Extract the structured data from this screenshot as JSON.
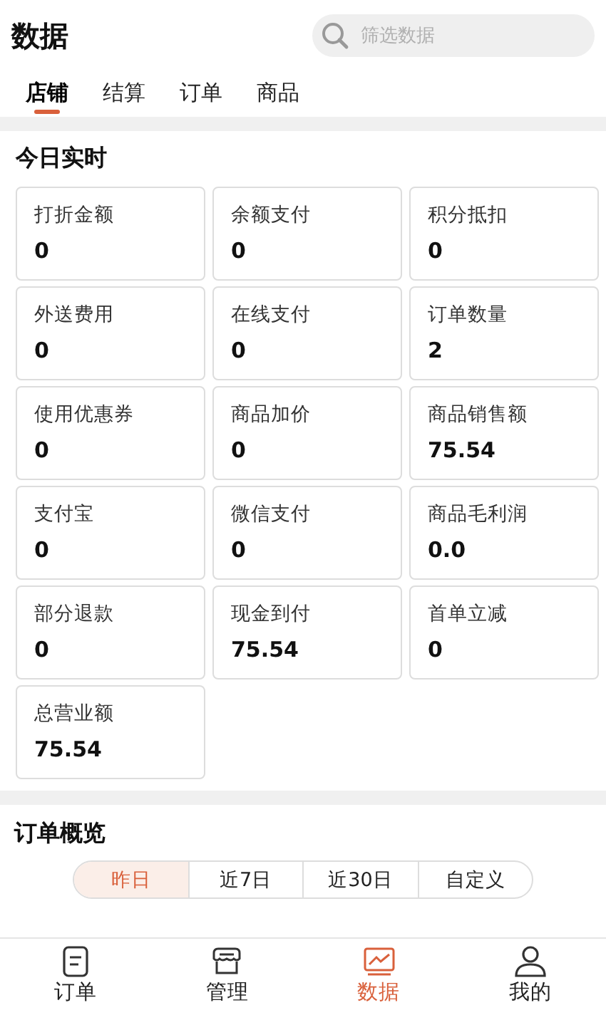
{
  "header": {
    "title": "数据",
    "search": {
      "placeholder": "筛选数据"
    }
  },
  "tabs": [
    {
      "label": "店铺",
      "selected": true
    },
    {
      "label": "结算",
      "selected": false
    },
    {
      "label": "订单",
      "selected": false
    },
    {
      "label": "商品",
      "selected": false
    }
  ],
  "today": {
    "title": "今日实时",
    "stats": [
      {
        "label": "打折金额",
        "value": "0"
      },
      {
        "label": "余额支付",
        "value": "0"
      },
      {
        "label": "积分抵扣",
        "value": "0"
      },
      {
        "label": "外送费用",
        "value": "0"
      },
      {
        "label": "在线支付",
        "value": "0"
      },
      {
        "label": "订单数量",
        "value": "2"
      },
      {
        "label": "使用优惠券",
        "value": "0"
      },
      {
        "label": "商品加价",
        "value": "0"
      },
      {
        "label": "商品销售额",
        "value": "75.54"
      },
      {
        "label": "支付宝",
        "value": "0"
      },
      {
        "label": "微信支付",
        "value": "0"
      },
      {
        "label": "商品毛利润",
        "value": "0.0"
      },
      {
        "label": "部分退款",
        "value": "0"
      },
      {
        "label": "现金到付",
        "value": "75.54"
      },
      {
        "label": "首单立减",
        "value": "0"
      },
      {
        "label": "总营业额",
        "value": "75.54"
      }
    ]
  },
  "orders": {
    "title": "订单概览",
    "ranges": [
      {
        "label": "昨日",
        "selected": true
      },
      {
        "label": "近7日",
        "selected": false
      },
      {
        "label": "近30日",
        "selected": false
      },
      {
        "label": "自定义",
        "selected": false
      }
    ]
  },
  "nav": [
    {
      "label": "订单",
      "kind": "orders",
      "selected": false
    },
    {
      "label": "管理",
      "kind": "store",
      "selected": false
    },
    {
      "label": "数据",
      "kind": "chart",
      "selected": true
    },
    {
      "label": "我的",
      "kind": "user",
      "selected": false
    }
  ]
}
